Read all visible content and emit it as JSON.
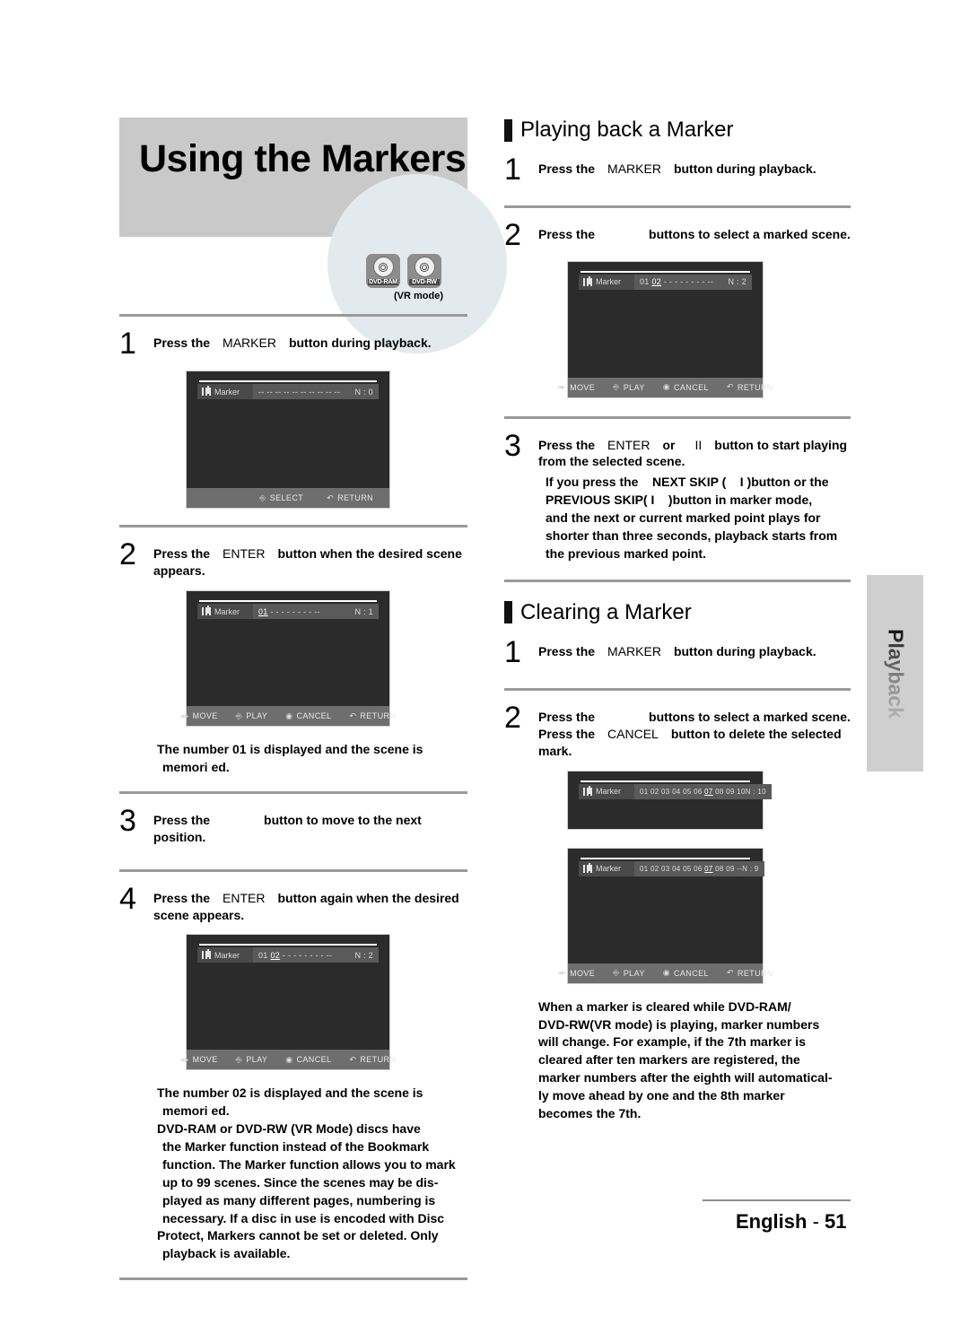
{
  "page": {
    "title": "Using the Markers",
    "vr_mode_caption": "(VR mode)",
    "side_tab_label": "Playback",
    "footer_language": "English",
    "footer_separator": "-",
    "footer_page": "51"
  },
  "disc_badges": [
    {
      "label": "DVD-RAM",
      "icon": "disc-icon"
    },
    {
      "label": "DVD-RW",
      "icon": "disc-icon"
    }
  ],
  "left_column": {
    "steps": [
      {
        "number": "1",
        "line1_a": "Press the",
        "line1_key": "MARKER",
        "line1_b": "button during playback."
      },
      {
        "number": "2",
        "line1_a": "Press the",
        "line1_key": "ENTER",
        "line1_b": "button when the desired scene",
        "line2": "appears."
      },
      {
        "number": "3",
        "line1_a": "Press the",
        "line1_key": "",
        "line1_b": "button to move to the next position."
      },
      {
        "number": "4",
        "line1_a": "Press the",
        "line1_key": "ENTER",
        "line1_b": "button again when the desired",
        "line2": "scene appears."
      }
    ],
    "note_after_step2": [
      "The number 01 is displayed and the scene is",
      "memori ed."
    ],
    "note_after_step4": [
      "The number 02 is displayed and the scene is",
      "memori ed.",
      "DVD-RAM or DVD-RW (VR Mode) discs have",
      "the Marker function instead of the Bookmark",
      "function. The Marker function allows you to mark",
      "up to 99 scenes. Since the scenes may be dis-",
      "played as many different pages, numbering is",
      "necessary. If a disc in use is encoded with Disc",
      "Protect, Markers cannot be set or deleted. Only",
      "playback is available."
    ],
    "osd_screens": [
      {
        "id": "osd-left-1",
        "panel_label": "Marker",
        "slots": "--  --  --  --  --  --  --  --  --  --",
        "selected_slot": "",
        "count_label": "N : 0",
        "footer_buttons": [
          {
            "glyph": "enter-glyph",
            "label": "SELECT"
          },
          {
            "glyph": "return-glyph",
            "label": "RETURN"
          }
        ]
      },
      {
        "id": "osd-left-2",
        "panel_label": "Marker",
        "slots_before": "",
        "selected_slot": "01",
        "slots_after": "-  -  -  -  -  -  -  -  --",
        "count_label": "N : 1",
        "footer_buttons": [
          {
            "glyph": "move-glyph",
            "label": "MOVE"
          },
          {
            "glyph": "enter-glyph",
            "label": "PLAY"
          },
          {
            "glyph": "cancel-glyph",
            "label": "CANCEL"
          },
          {
            "glyph": "return-glyph",
            "label": "RETURN"
          }
        ]
      },
      {
        "id": "osd-left-3",
        "panel_label": "Marker",
        "slots_before": "01",
        "selected_slot": "02",
        "slots_after": "-  -  -  -  -  -  -  -  --",
        "count_label": "N : 2",
        "footer_buttons": [
          {
            "glyph": "move-glyph",
            "label": "MOVE"
          },
          {
            "glyph": "enter-glyph",
            "label": "PLAY"
          },
          {
            "glyph": "cancel-glyph",
            "label": "CANCEL"
          },
          {
            "glyph": "return-glyph",
            "label": "RETURN"
          }
        ]
      }
    ]
  },
  "right_column": {
    "section_playing": {
      "heading": "Playing back a Marker",
      "steps": [
        {
          "number": "1",
          "line1_a": "Press the",
          "line1_key": "MARKER",
          "line1_b": "button during playback."
        },
        {
          "number": "2",
          "line1_a": "Press the",
          "line1_key": "",
          "line1_b": "buttons to select a marked scene."
        },
        {
          "number": "3",
          "line1_a": "Press the",
          "line1_key": "ENTER",
          "line1_mid": "or",
          "line1_key2": "II",
          "line1_b": "button to start playing",
          "line2": "from the selected scene.",
          "sub_lines": [
            "If you press the    NEXT SKIP (    I )button or the",
            "PREVIOUS SKIP( I    )button in marker mode,",
            "and the next or current marked point plays for",
            "shorter than three seconds, playback starts from",
            "the previous marked point."
          ]
        }
      ],
      "osd_screen": {
        "id": "osd-right-1",
        "panel_label": "Marker",
        "slots_before": "01",
        "selected_slot": "02",
        "slots_after": "-  -  -  -  -  -  -  -  --",
        "count_label": "N : 2",
        "footer_buttons": [
          {
            "glyph": "move-glyph",
            "label": "MOVE"
          },
          {
            "glyph": "enter-glyph",
            "label": "PLAY"
          },
          {
            "glyph": "cancel-glyph",
            "label": "CANCEL"
          },
          {
            "glyph": "return-glyph",
            "label": "RETURN"
          }
        ]
      }
    },
    "section_clearing": {
      "heading": "Clearing a Marker",
      "steps": [
        {
          "number": "1",
          "line1_a": "Press the",
          "line1_key": "MARKER",
          "line1_b": "button during playback."
        },
        {
          "number": "2",
          "line1_a": "Press the",
          "line1_key": "",
          "line1_b": "buttons to select a marked scene.",
          "line2_a": "Press the",
          "line2_key": "CANCEL",
          "line2_b": "button to delete the selected",
          "line3": "mark."
        }
      ],
      "osd_screens": [
        {
          "id": "osd-right-2",
          "panel_label": "Marker",
          "slots_before": "01 02 03 04 05 06",
          "selected_slot": "07",
          "slots_after": "08 09 10",
          "count_label": "N : 10",
          "footer_buttons": []
        },
        {
          "id": "osd-right-3",
          "panel_label": "Marker",
          "slots_before": "01 02 03 04 05 06",
          "selected_slot": "07",
          "slots_after": "08 09 --",
          "count_label": "N : 9",
          "footer_buttons": [
            {
              "glyph": "move-glyph",
              "label": "MOVE"
            },
            {
              "glyph": "enter-glyph",
              "label": "PLAY"
            },
            {
              "glyph": "cancel-glyph",
              "label": "CANCEL"
            },
            {
              "glyph": "return-glyph",
              "label": "RETURN"
            }
          ]
        }
      ],
      "note": [
        "When a marker is cleared while DVD-RAM/",
        "DVD-RW(VR mode) is playing, marker numbers",
        "will change. For example, if the 7th marker is",
        "cleared after ten markers are registered, the",
        "marker numbers after the eighth will automatical-",
        "ly move ahead by one and the 8th marker",
        "becomes the 7th."
      ]
    }
  }
}
